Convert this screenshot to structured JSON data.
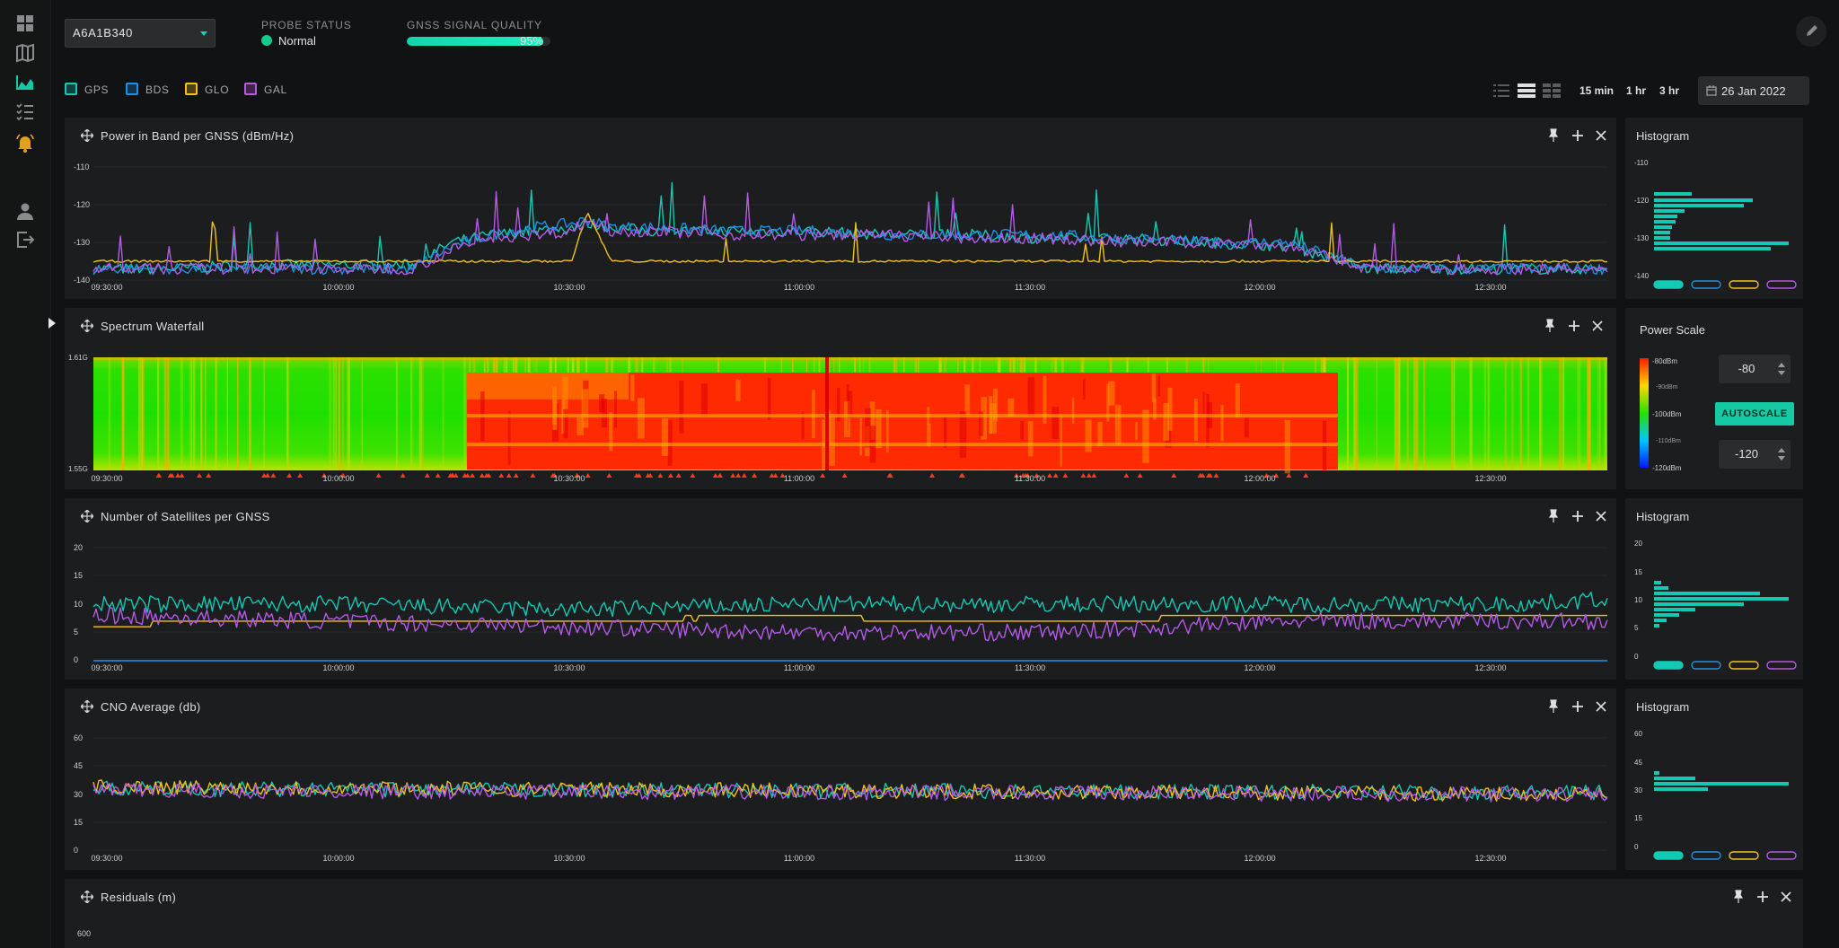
{
  "probe": {
    "selected": "A6A1B340"
  },
  "status": {
    "label": "PROBE STATUS",
    "value": "Normal",
    "color": "#16c98e"
  },
  "quality": {
    "label": "GNSS SIGNAL QUALITY",
    "value_text": "95%",
    "value": 0.95
  },
  "constellations": [
    {
      "name": "GPS",
      "color": "#14c8b4"
    },
    {
      "name": "BDS",
      "color": "#1e90e6"
    },
    {
      "name": "GLO",
      "color": "#f2c21b"
    },
    {
      "name": "GAL",
      "color": "#b45ae6"
    }
  ],
  "time_ranges": [
    "15 min",
    "1 hr",
    "3 hr"
  ],
  "date": "26 Jan 2022",
  "nav_icons": [
    "dashboard-icon",
    "map-icon",
    "chart-area-icon",
    "checklist-icon",
    "bell-icon",
    "user-icon",
    "logout-icon"
  ],
  "panels": {
    "power": {
      "title": "Power in Band per GNSS (dBm/Hz)",
      "side_title": "Histogram"
    },
    "waterfall": {
      "title": "Spectrum Waterfall",
      "side_title": "Power Scale"
    },
    "sats": {
      "title": "Number of Satellites per GNSS",
      "side_title": "Histogram"
    },
    "cno": {
      "title": "CNO Average (db)",
      "side_title": "Histogram"
    },
    "residuals": {
      "title": "Residuals (m)"
    }
  },
  "power_scale": {
    "max_value": "-80",
    "min_value": "-120",
    "autoscale_label": "AUTOSCALE",
    "labels": [
      "-80dBm",
      "-90dBm",
      "-100dBm",
      "-110dBm",
      "-120dBm"
    ]
  },
  "chart_data": [
    {
      "id": "power",
      "type": "line",
      "x_ticks": [
        "09:30:00",
        "10:00:00",
        "10:30:00",
        "11:00:00",
        "11:30:00",
        "12:00:00",
        "12:30:00"
      ],
      "y_ticks": [
        "-110",
        "-120",
        "-130",
        "-140"
      ],
      "ylim": [
        -140,
        -110
      ],
      "series": [
        {
          "name": "GPS",
          "color": "#14c8b4",
          "x": [
            0,
            10,
            20,
            30,
            40,
            45,
            50,
            55,
            60,
            62,
            65,
            70,
            80,
            90,
            100,
            110,
            120,
            130,
            140,
            150,
            160,
            170,
            180,
            185,
            190
          ],
          "values": [
            -137,
            -137,
            -136,
            -136,
            -136,
            -130,
            -128,
            -127,
            -126,
            -125,
            -126,
            -127,
            -127,
            -127,
            -128,
            -128,
            -129,
            -129,
            -130,
            -131,
            -137,
            -137,
            -137,
            -137,
            -137
          ]
        },
        {
          "name": "BDS",
          "color": "#1e90e6",
          "x": [
            0,
            10,
            20,
            30,
            40,
            45,
            50,
            55,
            60,
            62,
            65,
            70,
            80,
            90,
            100,
            110,
            120,
            130,
            140,
            150,
            160,
            170,
            180,
            185,
            190
          ],
          "values": [
            -137,
            -137,
            -137,
            -137,
            -137,
            -131,
            -128,
            -126,
            -125,
            -124,
            -126,
            -126,
            -127,
            -127,
            -128,
            -128,
            -128,
            -129,
            -130,
            -130,
            -137,
            -137,
            -137,
            -137,
            -137
          ]
        },
        {
          "name": "GLO",
          "color": "#f2c21b",
          "x": [
            0,
            10,
            20,
            30,
            40,
            45,
            50,
            55,
            60,
            62,
            65,
            70,
            80,
            90,
            100,
            110,
            120,
            130,
            140,
            150,
            160,
            170,
            180,
            185,
            190
          ],
          "values": [
            -135,
            -135,
            -135,
            -135,
            -135,
            -135,
            -135,
            -135,
            -135,
            -122,
            -135,
            -135,
            -135,
            -135,
            -135,
            -135,
            -135,
            -135,
            -135,
            -135,
            -135,
            -135,
            -135,
            -135,
            -135
          ]
        },
        {
          "name": "GAL",
          "color": "#b45ae6",
          "x": [
            0,
            10,
            20,
            30,
            40,
            45,
            50,
            55,
            60,
            62,
            65,
            70,
            80,
            90,
            100,
            110,
            120,
            130,
            140,
            150,
            160,
            170,
            180,
            185,
            190
          ],
          "values": [
            -137,
            -137,
            -137,
            -137,
            -137,
            -132,
            -129,
            -128,
            -127,
            -124,
            -127,
            -127,
            -128,
            -128,
            -128,
            -129,
            -129,
            -130,
            -130,
            -131,
            -137,
            -137,
            -137,
            -137,
            -138
          ]
        }
      ],
      "histogram": {
        "y_ticks": [
          "-110",
          "-120",
          "-130",
          "-140"
        ]
      }
    },
    {
      "id": "waterfall",
      "type": "heatmap",
      "x_ticks": [
        "09:30:00",
        "10:00:00",
        "10:30:00",
        "11:00:00",
        "11:30:00",
        "12:00:00",
        "12:30:00"
      ],
      "y_ticks": [
        "1.61G",
        "1.55G"
      ]
    },
    {
      "id": "sats",
      "type": "line",
      "x_ticks": [
        "09:30:00",
        "10:00:00",
        "10:30:00",
        "11:00:00",
        "11:30:00",
        "12:00:00",
        "12:30:00"
      ],
      "y_ticks": [
        "20",
        "15",
        "10",
        "5",
        "0"
      ],
      "ylim": [
        0,
        20
      ],
      "series": [
        {
          "name": "GPS",
          "color": "#14c8b4",
          "x": [
            0,
            30,
            60,
            90,
            120,
            150,
            180,
            190
          ],
          "values": [
            10,
            10,
            9,
            10,
            10,
            10,
            10,
            11
          ]
        },
        {
          "name": "BDS",
          "color": "#1e90e6",
          "x": [
            0,
            190
          ],
          "values": [
            0,
            0
          ]
        },
        {
          "name": "GLO",
          "color": "#f2c21b",
          "x": [
            0,
            30,
            60,
            90,
            120,
            150,
            180,
            190
          ],
          "values": [
            6,
            7,
            7,
            8,
            8,
            8,
            8,
            8
          ]
        },
        {
          "name": "GAL",
          "color": "#b45ae6",
          "x": [
            0,
            30,
            60,
            90,
            120,
            150,
            180,
            190
          ],
          "values": [
            8,
            7,
            6,
            5,
            5,
            7,
            7,
            7
          ]
        }
      ],
      "histogram": {
        "y_ticks": [
          "20",
          "15",
          "10",
          "5",
          "0"
        ]
      }
    },
    {
      "id": "cno",
      "type": "line",
      "x_ticks": [
        "09:30:00",
        "10:00:00",
        "10:30:00",
        "11:00:00",
        "11:30:00",
        "12:00:00",
        "12:30:00"
      ],
      "y_ticks": [
        "60",
        "45",
        "30",
        "15",
        "0"
      ],
      "ylim": [
        0,
        60
      ],
      "series": [
        {
          "name": "GPS",
          "color": "#14c8b4",
          "x": [
            0,
            190
          ],
          "values": [
            33,
            31
          ]
        },
        {
          "name": "GLO",
          "color": "#f2c21b",
          "x": [
            0,
            190
          ],
          "values": [
            34,
            30
          ]
        },
        {
          "name": "GAL",
          "color": "#b45ae6",
          "x": [
            0,
            190
          ],
          "values": [
            32,
            30
          ]
        }
      ],
      "histogram": {
        "y_ticks": [
          "60",
          "45",
          "30",
          "15",
          "0"
        ]
      }
    },
    {
      "id": "residuals",
      "type": "line",
      "y_ticks": [
        "600"
      ]
    }
  ]
}
